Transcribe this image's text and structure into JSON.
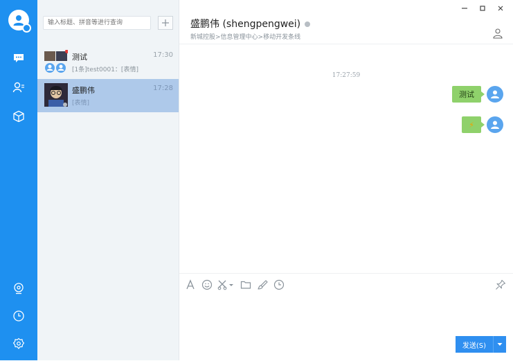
{
  "rail": {
    "nav": [
      "chat-icon",
      "contacts-icon",
      "apps-cube-icon"
    ],
    "bottom": [
      "location-icon",
      "history-clock-icon",
      "settings-gear-icon"
    ]
  },
  "search": {
    "placeholder": "输入标题、拼音等进行查询"
  },
  "conversations": [
    {
      "name": "测试",
      "time": "17:30",
      "preview": "[1条]test0001：[表情]"
    },
    {
      "name": "盛鹏伟",
      "time": "17:28",
      "preview": "[表情]"
    }
  ],
  "chat": {
    "contact_name": "盛鹏伟 (shengpengwei)",
    "breadcrumb": "新城控股>信息管理中心>移动开发条线",
    "timestamp": "17:27:59",
    "messages": [
      {
        "text": "测试"
      },
      {
        "text": "⚡"
      }
    ]
  },
  "composer": {
    "tools": [
      "font-icon",
      "emoji-icon",
      "screenshot-icon",
      "folder-icon",
      "brush-icon",
      "history-icon"
    ],
    "send_label": "发送(S)"
  },
  "colors": {
    "rail": "#1e90f0",
    "selected": "#aec9ea",
    "bubble": "#8fd16b",
    "send": "#2f8ff0"
  }
}
